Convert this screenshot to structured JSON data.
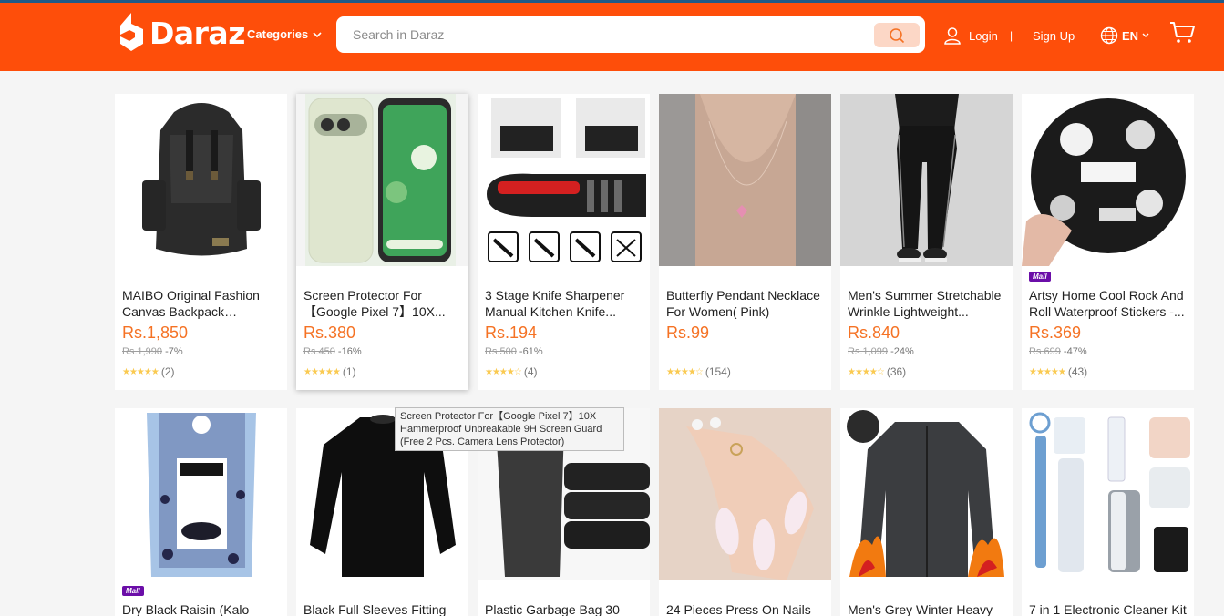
{
  "header": {
    "logo_text": "Daraz",
    "categories_label": "Categories",
    "search_placeholder": "Search in Daraz",
    "login_label": "Login",
    "separator": "|",
    "signup_label": "Sign Up",
    "language": "EN",
    "colors": {
      "brand": "#fe4e0a",
      "search_button": "#fcd7c6"
    }
  },
  "products": [
    {
      "name": "MAIBO Original Fashion Canvas Backpack College...",
      "price": "Rs.1,850",
      "original_price": "Rs.1,990",
      "discount": "-7%",
      "reviews": "(2)",
      "mall": ""
    },
    {
      "name": "Screen Protector For 【Google Pixel 7】10X...",
      "price": "Rs.380",
      "original_price": "Rs.450",
      "discount": "-16%",
      "reviews": "(1)",
      "mall": ""
    },
    {
      "name": "3 Stage Knife Sharpener Manual Kitchen Knife...",
      "price": "Rs.194",
      "original_price": "Rs.500",
      "discount": "-61%",
      "reviews": "(4)",
      "mall": ""
    },
    {
      "name": "Butterfly Pendant Necklace For Women( Pink)",
      "price": "Rs.99",
      "original_price": "",
      "discount": "",
      "reviews": "(154)",
      "mall": ""
    },
    {
      "name": "Men's Summer Stretchable Wrinkle Lightweight...",
      "price": "Rs.840",
      "original_price": "Rs.1,099",
      "discount": "-24%",
      "reviews": "(36)",
      "mall": ""
    },
    {
      "name": "Artsy Home Cool Rock And Roll Waterproof Stickers -...",
      "price": "Rs.369",
      "original_price": "Rs.699",
      "discount": "-47%",
      "reviews": "(43)",
      "mall": "Mall"
    },
    {
      "name": "Dry Black Raisin (Kalo",
      "mall": "Mall"
    },
    {
      "name": "Black Full Sleeves Fitting",
      "mall": ""
    },
    {
      "name": "Plastic Garbage Bag 30",
      "mall": ""
    },
    {
      "name": "24 Pieces Press On Nails",
      "mall": ""
    },
    {
      "name": "Men's Grey Winter Heavy",
      "mall": ""
    },
    {
      "name": "7 in 1 Electronic Cleaner Kit",
      "mall": ""
    }
  ],
  "tooltip": "Screen Protector For【Google Pixel 7】10X Hammerproof Unbreakable 9H Screen Guard (Free 2 Pcs. Camera Lens Protector)"
}
